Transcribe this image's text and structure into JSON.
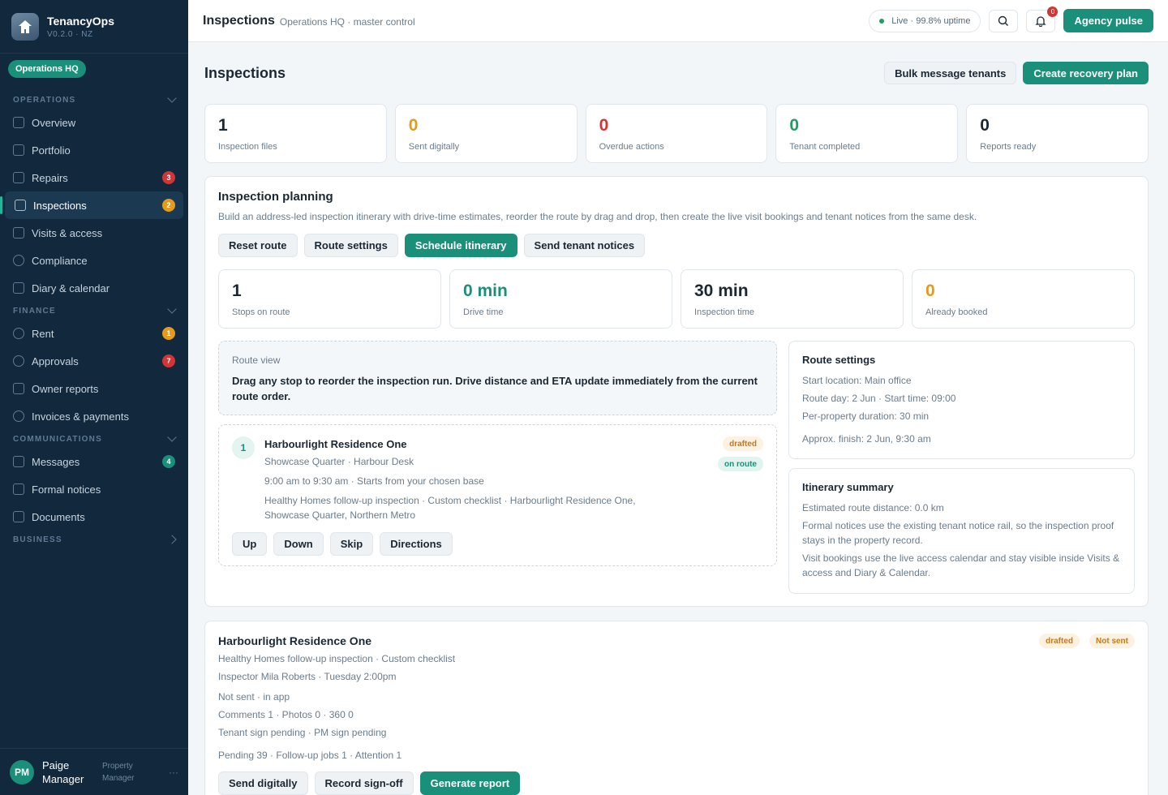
{
  "brand": {
    "name": "TenancyOps",
    "version": "V0.2.0 · NZ",
    "org": "Operations HQ"
  },
  "sidebar": {
    "sections": [
      {
        "title": "OPERATIONS",
        "items": [
          {
            "label": "Overview",
            "icon": "home-icon"
          },
          {
            "label": "Portfolio",
            "icon": "bar-chart-icon"
          },
          {
            "label": "Repairs",
            "icon": "wrench-icon",
            "badge": "3",
            "badge_color": "#d23535"
          },
          {
            "label": "Inspections",
            "icon": "clipboard-icon",
            "badge": "2",
            "badge_color": "#e59a1a",
            "active": true
          },
          {
            "label": "Visits & access",
            "icon": "calendar-icon"
          },
          {
            "label": "Compliance",
            "icon": "shield-icon"
          },
          {
            "label": "Diary & calendar",
            "icon": "calendar-icon"
          }
        ]
      },
      {
        "title": "FINANCE",
        "items": [
          {
            "label": "Rent",
            "icon": "dollar-icon",
            "badge": "1",
            "badge_color": "#e59a1a"
          },
          {
            "label": "Approvals",
            "icon": "check-circle-icon",
            "badge": "7",
            "badge_color": "#d23535"
          },
          {
            "label": "Owner reports",
            "icon": "bar-chart-icon"
          },
          {
            "label": "Invoices & payments",
            "icon": "dollar-icon"
          }
        ]
      },
      {
        "title": "COMMUNICATIONS",
        "items": [
          {
            "label": "Messages",
            "icon": "message-icon",
            "badge": "4",
            "badge_color": "#1a8f7a"
          },
          {
            "label": "Formal notices",
            "icon": "document-icon"
          },
          {
            "label": "Documents",
            "icon": "folder-icon"
          }
        ]
      },
      {
        "title": "BUSINESS",
        "items": []
      }
    ]
  },
  "user": {
    "initials": "PM",
    "name": "Paige Manager",
    "role": "Property Manager"
  },
  "topbar": {
    "title": "Inspections",
    "subtitle": "Operations HQ · master control",
    "status": "Live · 99.8% uptime",
    "notifications": "0",
    "pulse_label": "Agency pulse"
  },
  "page": {
    "title": "Inspections",
    "actions": {
      "bulk": "Bulk message tenants",
      "recovery": "Create recovery plan"
    },
    "stats": [
      {
        "value": "1",
        "label": "Inspection files",
        "color": "#1b2733"
      },
      {
        "value": "0",
        "label": "Sent digitally",
        "color": "#e59a1a"
      },
      {
        "value": "0",
        "label": "Overdue actions",
        "color": "#d23535"
      },
      {
        "value": "0",
        "label": "Tenant completed",
        "color": "#1f9d62"
      },
      {
        "value": "0",
        "label": "Reports ready",
        "color": "#1b2733"
      }
    ]
  },
  "planning": {
    "title": "Inspection planning",
    "description": "Build an address-led inspection itinerary with drive-time estimates, reorder the route by drag and drop, then create the live visit bookings and tenant notices from the same desk.",
    "buttons": {
      "reset": "Reset route",
      "settings": "Route settings",
      "schedule": "Schedule itinerary",
      "notices": "Send tenant notices"
    },
    "metrics": [
      {
        "value": "1",
        "label": "Stops on route",
        "color": "#1b2733"
      },
      {
        "value": "0 min",
        "label": "Drive time",
        "color": "#1a8f7a"
      },
      {
        "value": "30 min",
        "label": "Inspection time",
        "color": "#1b2733"
      },
      {
        "value": "0",
        "label": "Already booked",
        "color": "#e59a1a"
      }
    ],
    "route_view": {
      "label": "Route view",
      "text": "Drag any stop to reorder the inspection run. Drive distance and ETA update immediately from the current route order."
    },
    "stop": {
      "number": "1",
      "title": "Harbourlight Residence One",
      "location": "Showcase Quarter · Harbour Desk",
      "time": "9:00 am to 9:30 am · Starts from your chosen base",
      "desc": "Healthy Homes follow-up inspection · Custom checklist · Harbourlight Residence One, Showcase Quarter, Northern Metro",
      "pill1": "drafted",
      "pill2": "on route",
      "buttons": {
        "up": "Up",
        "down": "Down",
        "skip": "Skip",
        "directions": "Directions"
      }
    },
    "route_settings": {
      "title": "Route settings",
      "start": "Start location: Main office",
      "day": "Route day: 2 Jun · Start time: 09:00",
      "duration": "Per-property duration: 30 min",
      "finish": "Approx. finish: 2 Jun, 9:30 am"
    },
    "summary": {
      "title": "Itinerary summary",
      "distance": "Estimated route distance: 0.0 km",
      "notices": "Formal notices use the existing tenant notice rail, so the inspection proof stays in the property record.",
      "bookings": "Visit bookings use the live access calendar and stay visible inside Visits & access and Diary & Calendar."
    }
  },
  "record": {
    "title": "Harbourlight Residence One",
    "type": "Healthy Homes follow-up inspection · Custom checklist",
    "inspector": "Inspector Mila Roberts · Tuesday 2:00pm",
    "delivery": "Not sent · in app",
    "counts": "Comments 1 · Photos 0 · 360 0",
    "signoff": "Tenant sign pending · PM sign pending",
    "pending": "Pending 39 · Follow-up jobs 1 · Attention 1",
    "pill1": "drafted",
    "pill2": "Not sent",
    "buttons": {
      "send": "Send digitally",
      "signoff": "Record sign-off",
      "report": "Generate report"
    }
  }
}
